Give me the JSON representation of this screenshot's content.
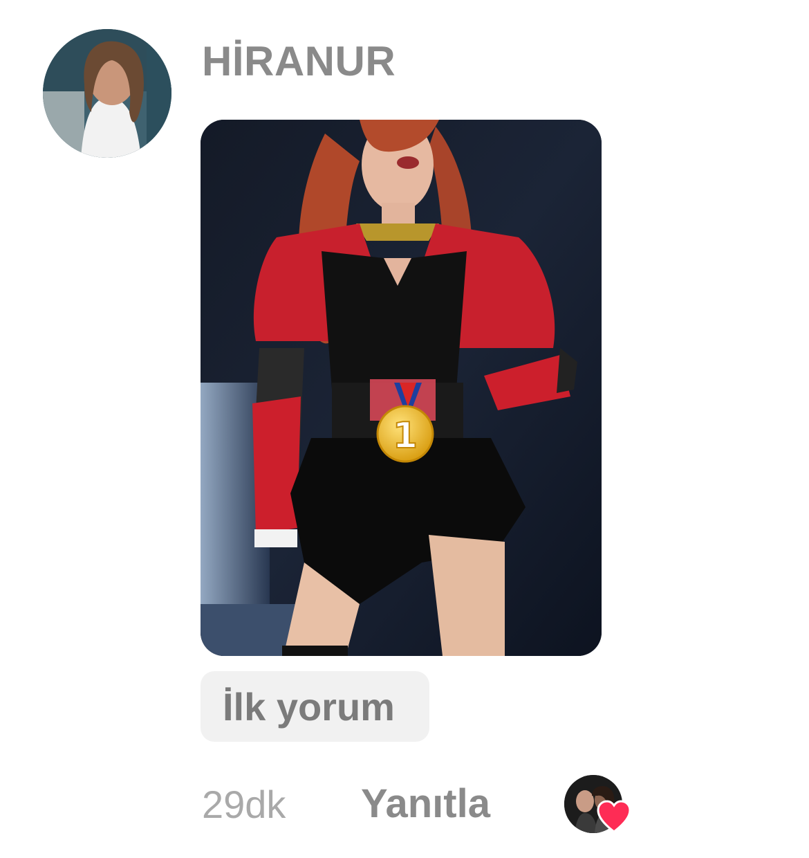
{
  "comment": {
    "username": "HİRANUR",
    "caption": "İlk yorum",
    "time": "29dk",
    "reply_label": "Yanıtla"
  },
  "icons": {
    "avatar": "user-avatar-photo",
    "liker": "author-liked-avatar",
    "heart": "heart-icon",
    "medal": "first-place-medal-emoji"
  },
  "colors": {
    "heart": "#fe2c55",
    "username": "#8a8a8a",
    "time": "#a9a9a9",
    "bubble": "#f1f1f1"
  }
}
